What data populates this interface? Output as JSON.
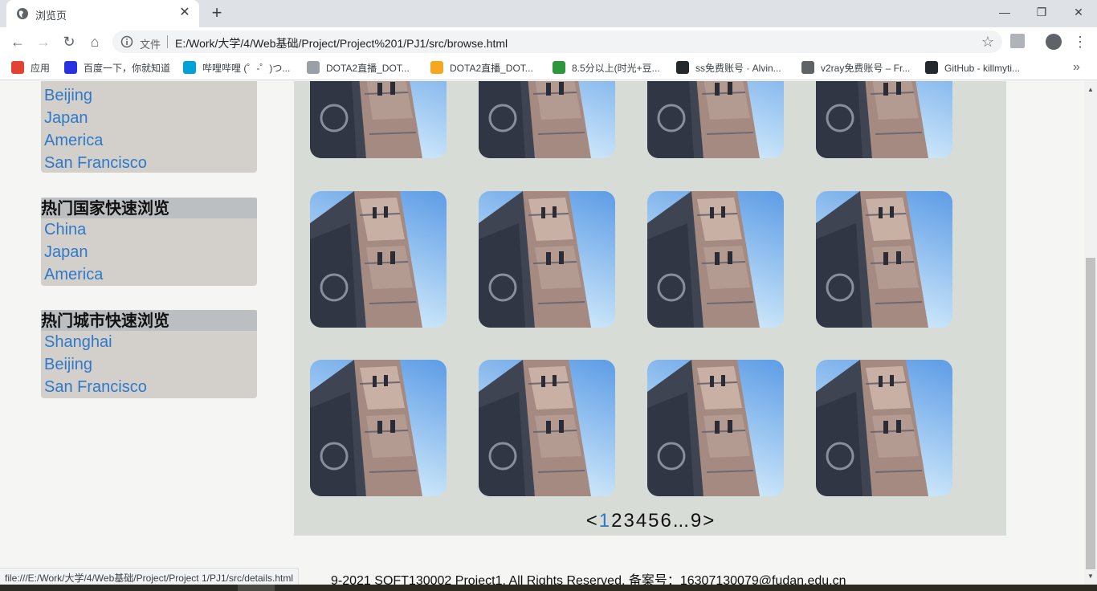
{
  "browser": {
    "tab_title": "浏览页",
    "tab_close": "✕",
    "new_tab": "+",
    "window_controls": {
      "minimize": "—",
      "restore": "❐",
      "close": "✕"
    },
    "nav": {
      "back": "←",
      "forward": "→",
      "reload": "↻",
      "home": "⌂"
    },
    "address": {
      "scheme_label": "文件",
      "url": "E:/Work/大学/4/Web基础/Project/Project%201/PJ1/src/browse.html"
    },
    "star": "☆",
    "menu": "⋮",
    "bookmarks": [
      {
        "label": "应用",
        "icon": "apps-grid-icon",
        "color": "#e34133"
      },
      {
        "label": "百度一下，你就知道",
        "icon": "baidu-paw-icon",
        "color": "#2932e1"
      },
      {
        "label": "哔哩哔哩 (゜-゜)つ...",
        "icon": "bilibili-tv-icon",
        "color": "#00a1d6"
      },
      {
        "label": "DOTA2直播_DOT...",
        "icon": "dota-feather-icon",
        "color": "#9aa0a6"
      },
      {
        "label": "DOTA2直播_DOT...",
        "icon": "douyu-fish-icon",
        "color": "#f5a623"
      },
      {
        "label": "8.5分以上(时光+豆...",
        "icon": "douban-icon",
        "color": "#2e963d"
      },
      {
        "label": "ss免费账号 · Alvin...",
        "icon": "github-icon",
        "color": "#24292e"
      },
      {
        "label": "v2ray免费账号 – Fr...",
        "icon": "globe-icon",
        "color": "#5f6368"
      },
      {
        "label": "GitHub - killmyti...",
        "icon": "github-icon",
        "color": "#24292e"
      }
    ],
    "bookmarks_more": "»",
    "status_url": "file:///E:/Work/大学/4/Web基础/Project/Project 1/PJ1/src/details.html"
  },
  "sidebar": {
    "partial_box": {
      "items": [
        "Beijing",
        "Japan",
        "America",
        "San Francisco"
      ]
    },
    "hot_countries": {
      "title": "热门国家快速浏览",
      "items": [
        "China",
        "Japan",
        "America"
      ]
    },
    "hot_cities": {
      "title": "热门城市快速浏览",
      "items": [
        "Shanghai",
        "Beijing",
        "San Francisco"
      ]
    }
  },
  "gallery": {
    "image_subject": "tower-cathedral-photo",
    "sky_color_top": "#5d9ce6",
    "sky_color_bottom": "#d4ecfb"
  },
  "pagination": {
    "prev": "<",
    "pages": [
      "1",
      "2",
      "3",
      "4",
      "5",
      "6",
      "...",
      "9"
    ],
    "current": "1",
    "next": ">"
  },
  "footer": {
    "text": "9-2021 SOFT130002 Project1. All Rights Reserved. 备案号：16307130079@fudan.edu.cn"
  }
}
